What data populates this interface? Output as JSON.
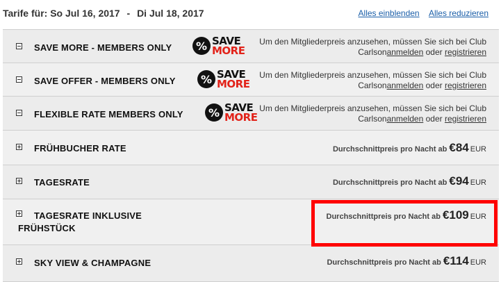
{
  "header": {
    "label": "Tarife für:",
    "date_from": "So Jul 16, 2017",
    "sep": "-",
    "date_to": "Di Jul 18, 2017",
    "show_all": "Alles einblenden",
    "collapse_all": "Alles reduzieren"
  },
  "members_msg": {
    "text": "Um den Mitgliederpreis anzusehen, müssen Sie sich bei Club Carlson",
    "login": "anmelden",
    "or": " oder ",
    "register": "registrieren"
  },
  "save_badge": {
    "pct": "%",
    "line1": "SAVE",
    "line2": "MORE",
    "line2_color": "#e2231a"
  },
  "price_label": "Durchschnittpreis pro Nacht ab",
  "rates": [
    {
      "name": "SAVE MORE - MEMBERS ONLY",
      "expanded": true
    },
    {
      "name": "SAVE OFFER - MEMBERS ONLY",
      "expanded": true
    },
    {
      "name": "FLEXIBLE RATE MEMBERS ONLY",
      "expanded": true
    },
    {
      "name": "FRÜHBUCHER RATE",
      "price": "€84",
      "currency": "EUR",
      "expanded": false
    },
    {
      "name": "TAGESRATE",
      "price": "€94",
      "currency": "EUR",
      "expanded": false
    },
    {
      "name": "TAGESRATE INKLUSIVE",
      "name2": "FRÜHSTÜCK",
      "price": "€109",
      "currency": "EUR",
      "expanded": false,
      "highlighted": true
    },
    {
      "name": "SKY VIEW & CHAMPAGNE",
      "price": "€114",
      "currency": "EUR",
      "expanded": false
    }
  ],
  "highlight_color": "#ff0000"
}
